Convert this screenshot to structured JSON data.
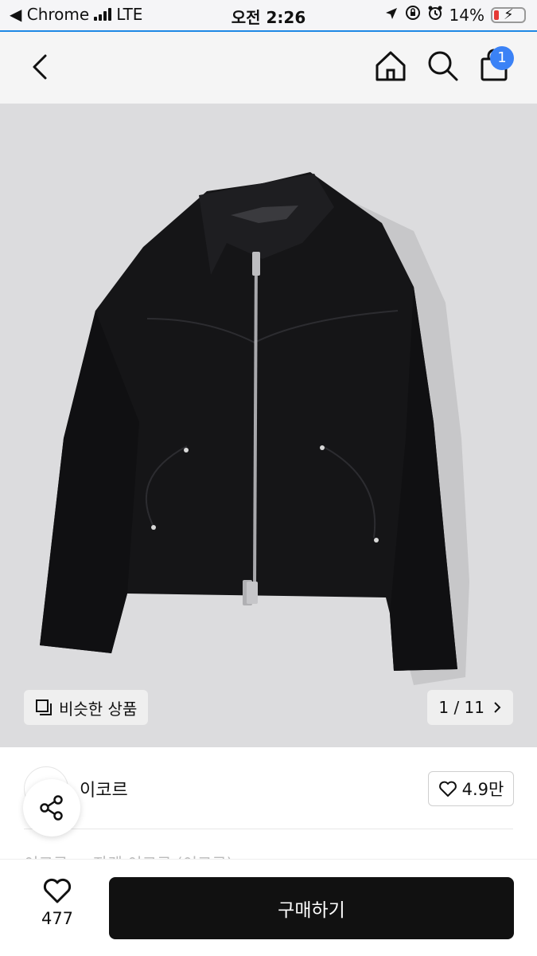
{
  "status_bar": {
    "back_app": "◀ Chrome",
    "network": "LTE",
    "time": "오전 2:26",
    "battery": "14%"
  },
  "header": {
    "cart_count": "1"
  },
  "gallery": {
    "similar_label": "비슷한 상품",
    "counter": "1 / 11"
  },
  "shop": {
    "name": "이코르",
    "likes": "4.9만"
  },
  "product": {
    "title_partial": "이코르 ... 자켓 이코르 (이코르)"
  },
  "bottom_bar": {
    "like_count": "477",
    "buy_label": "구매하기"
  },
  "colors": {
    "accent": "#1e88e5",
    "badge": "#3b82f6",
    "buy_button": "#111111"
  }
}
